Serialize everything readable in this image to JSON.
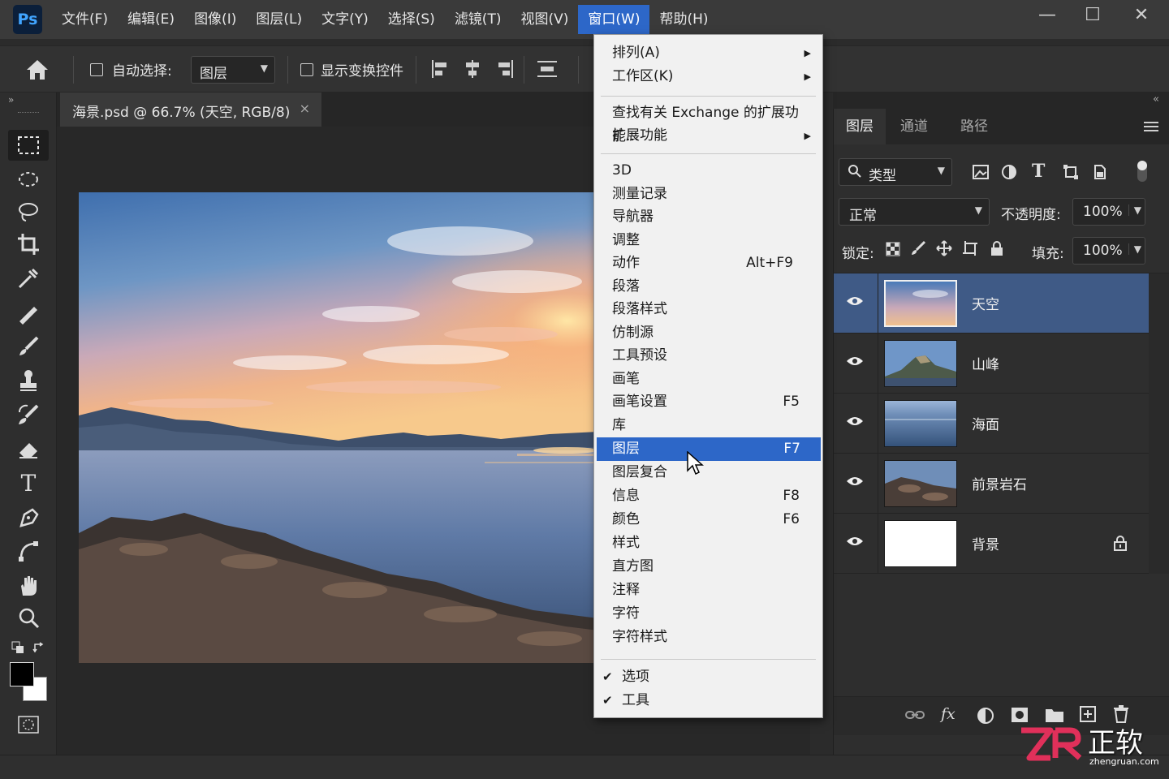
{
  "app": {
    "logo": "Ps"
  },
  "menubar": {
    "items": [
      "文件(F)",
      "编辑(E)",
      "图像(I)",
      "图层(L)",
      "文字(Y)",
      "选择(S)",
      "滤镜(T)",
      "视图(V)",
      "窗口(W)",
      "帮助(H)"
    ],
    "active": "窗口(W)"
  },
  "window_controls": {
    "minimize": "—",
    "maximize": "☐",
    "close": "✕"
  },
  "options_bar": {
    "auto_select_label": "自动选择:",
    "auto_select_value": "图层",
    "show_transform_label": "显示变换控件"
  },
  "document": {
    "tab_title": "海景.psd @ 66.7% (天空, RGB/8)",
    "close": "×"
  },
  "window_menu": {
    "items": [
      {
        "label": "排列(A)",
        "submenu": true
      },
      {
        "label": "工作区(K)",
        "submenu": true
      },
      {
        "label": "查找有关 Exchange 的扩展功能..."
      },
      {
        "label": "扩展功能",
        "submenu": true
      },
      {
        "label": "3D"
      },
      {
        "label": "测量记录"
      },
      {
        "label": "导航器"
      },
      {
        "label": "调整"
      },
      {
        "label": "动作",
        "shortcut": "Alt+F9"
      },
      {
        "label": "段落"
      },
      {
        "label": "段落样式"
      },
      {
        "label": "仿制源"
      },
      {
        "label": "工具预设"
      },
      {
        "label": "画笔"
      },
      {
        "label": "画笔设置",
        "shortcut": "F5"
      },
      {
        "label": "库"
      },
      {
        "label": "图层",
        "shortcut": "F7",
        "highlighted": true
      },
      {
        "label": "图层复合"
      },
      {
        "label": "信息",
        "shortcut": "F8"
      },
      {
        "label": "颜色",
        "shortcut": "F6"
      },
      {
        "label": "样式"
      },
      {
        "label": "直方图"
      },
      {
        "label": "注释"
      },
      {
        "label": "字符"
      },
      {
        "label": "字符样式"
      },
      {
        "label": "选项",
        "checked": true
      },
      {
        "label": "工具",
        "checked": true
      }
    ]
  },
  "layers_panel": {
    "tabs": [
      "图层",
      "通道",
      "路径"
    ],
    "active_tab": "图层",
    "filter_label": "类型",
    "blend_mode": "正常",
    "opacity_label": "不透明度:",
    "opacity_value": "100%",
    "lock_label": "锁定:",
    "fill_label": "填充:",
    "fill_value": "100%",
    "layers": [
      {
        "name": "天空",
        "selected": true,
        "visible": true
      },
      {
        "name": "山峰",
        "visible": true
      },
      {
        "name": "海面",
        "visible": true
      },
      {
        "name": "前景岩石",
        "visible": true
      },
      {
        "name": "背景",
        "visible": true,
        "locked": true
      }
    ],
    "bottom_fx": "fx"
  },
  "watermark": {
    "brand": "正软",
    "url": "zhengruan.com"
  },
  "colors": {
    "accent": "#2d67c8",
    "selected_layer": "#3f5a86",
    "panel": "#2e2e2e",
    "menubar": "#3a3a3a"
  }
}
